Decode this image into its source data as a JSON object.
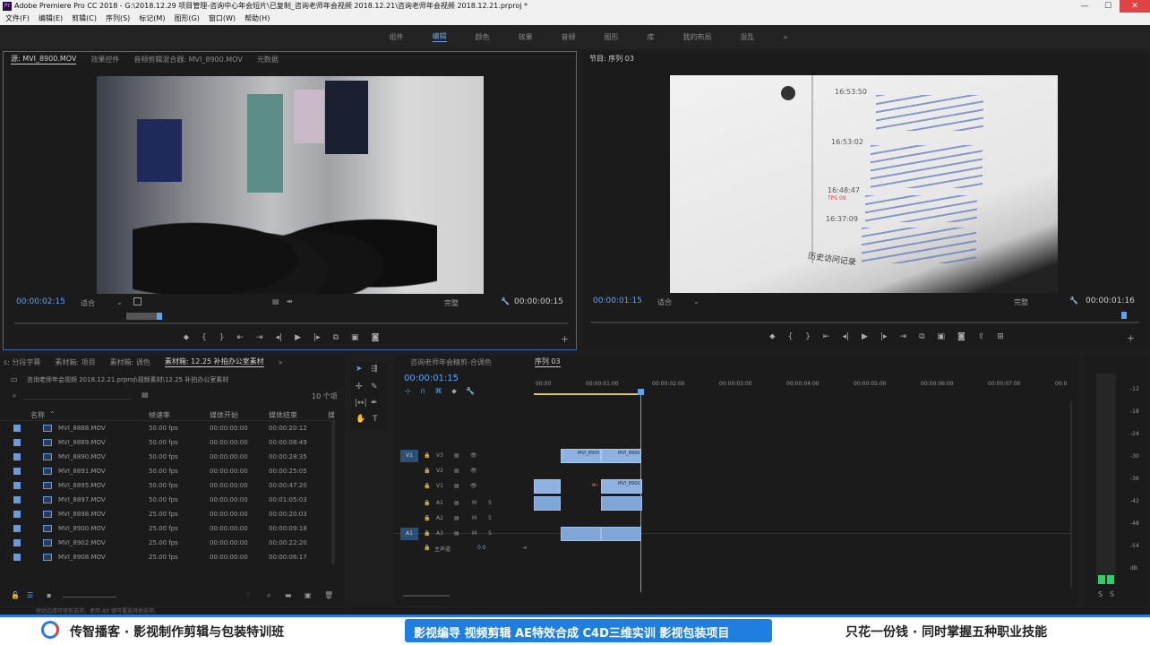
{
  "title_bar": "Adobe Premiere Pro CC 2018 - G:\\2018.12.29 项目管理-咨询中心年会短片\\已复制_咨询老师年会视频 2018.12.21\\咨询老师年会视频 2018.12.21.prproj *",
  "menu": [
    "文件(F)",
    "编辑(E)",
    "剪辑(C)",
    "序列(S)",
    "标记(M)",
    "图形(G)",
    "窗口(W)",
    "帮助(H)"
  ],
  "workspaces": [
    "组件",
    "编辑",
    "颜色",
    "效果",
    "音频",
    "图形",
    "库",
    "我的布局",
    "混乱"
  ],
  "workspace_more": "»",
  "source_tabs": [
    "源: MVI_8900.MOV",
    "效果控件",
    "音频剪辑混合器: MVI_8900.MOV",
    "元数据"
  ],
  "source": {
    "timecode": "00:00:02:15",
    "fit": "适合",
    "quality": "完整",
    "duration": "00:00:00:15"
  },
  "program_tab": "节目: 序列 03",
  "program": {
    "timecode": "00:00:01:15",
    "fit": "适合",
    "quality": "完整",
    "duration": "00:00:01:16"
  },
  "program_screen": {
    "times": [
      "16:53:50",
      "16:53:02",
      "16:48:47",
      "16:37:09"
    ],
    "badge": "TPS 09",
    "footer": "历史访问记录"
  },
  "project_tabs": [
    "s: 分段字幕",
    "素材箱: 项目",
    "素材箱: 调色",
    "素材箱: 12.25 补拍办公室素材"
  ],
  "project_path": "咨询老师年会视频 2018.12.21.prproj\\视频素材\\12.25 补拍办公室素材",
  "item_count": "10 个项",
  "columns": [
    "名称",
    "帧速率",
    "媒体开始",
    "媒体结束",
    "媒"
  ],
  "files": [
    {
      "name": "MVI_8888.MOV",
      "fps": "50.00 fps",
      "start": "00:00:00:00",
      "end": "00:00:20:12"
    },
    {
      "name": "MVI_8889.MOV",
      "fps": "50.00 fps",
      "start": "00:00:00:00",
      "end": "00:00:08:49"
    },
    {
      "name": "MVI_8890.MOV",
      "fps": "50.00 fps",
      "start": "00:00:00:00",
      "end": "00:00:28:35"
    },
    {
      "name": "MVI_8891.MOV",
      "fps": "50.00 fps",
      "start": "00:00:00:00",
      "end": "00:00:25:05"
    },
    {
      "name": "MVI_8895.MOV",
      "fps": "50.00 fps",
      "start": "00:00:00:00",
      "end": "00:00:47:20"
    },
    {
      "name": "MVI_8897.MOV",
      "fps": "50.00 fps",
      "start": "00:00:00:00",
      "end": "00:01:05:03"
    },
    {
      "name": "MVI_8898.MOV",
      "fps": "25.00 fps",
      "start": "00:00:00:00",
      "end": "00:00:20:03"
    },
    {
      "name": "MVI_8900.MOV",
      "fps": "25.00 fps",
      "start": "00:00:00:00",
      "end": "00:00:09:18"
    },
    {
      "name": "MVI_8902.MOV",
      "fps": "25.00 fps",
      "start": "00:00:00:00",
      "end": "00:00:22:20"
    },
    {
      "name": "MVI_8908.MOV",
      "fps": "25.00 fps",
      "start": "00:00:00:00",
      "end": "00:00:06:17"
    }
  ],
  "timeline_tabs": [
    "咨询老师年会精剪-合调色",
    "序列 03"
  ],
  "timeline": {
    "timecode": "00:00:01:15",
    "ruler": [
      "00:00",
      "00:00:01:00",
      "00:00:02:00",
      "00:00:03:00",
      "00:00:04:00",
      "00:00:05:00",
      "00:00:06:00",
      "00:00:07:00",
      "00:0"
    ],
    "tracks": [
      "V3",
      "V2",
      "V1",
      "A1",
      "A2",
      "A3"
    ],
    "video_src": "V1",
    "audio_src": "A1",
    "master": "主声道",
    "master_val": "0.0",
    "clip_labels": [
      "MVI_8900",
      "MVI_8900",
      "MVI_8900"
    ]
  },
  "meter_labels": [
    "-12",
    "-18",
    "-24",
    "-30",
    "-36",
    "-42",
    "-48",
    "-54",
    "dB"
  ],
  "meter_solo": [
    "S",
    "S"
  ],
  "status": "拖动边缘可修剪选项，使用 Alt 键可覆盖其他选项。",
  "banner": {
    "left": "传智播客 · 影视制作剪辑与包装特训班",
    "middle": "影视编导  视频剪辑  AE特效合成  C4D三维实训  影视包装项目",
    "right": "只花一份钱 · 同时掌握五种职业技能"
  },
  "colors": {
    "accent": "#5ea3ef",
    "clip": "#8db2e0",
    "banner_blue": "#2a7be0"
  }
}
